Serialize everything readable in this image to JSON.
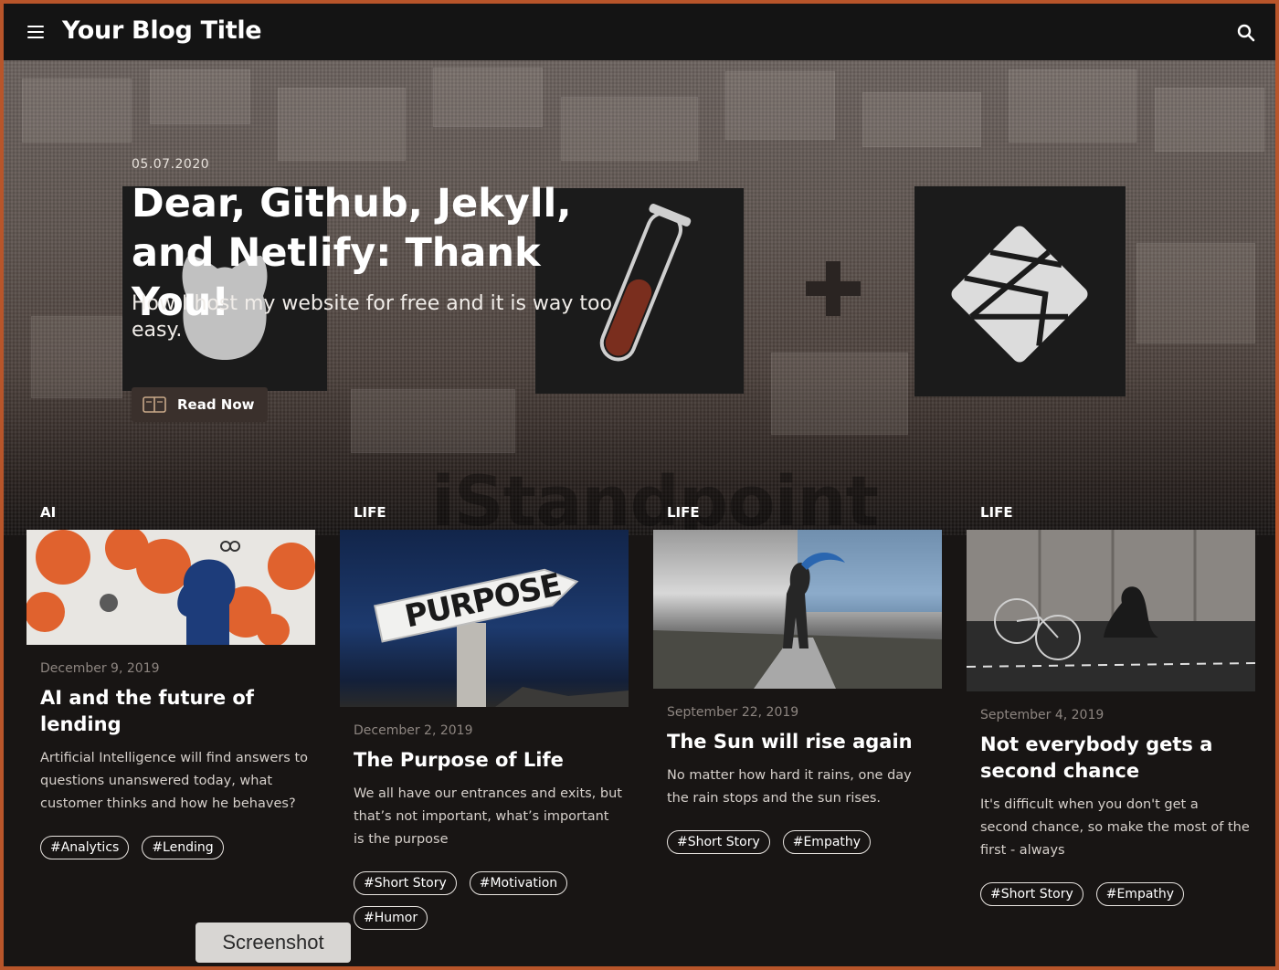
{
  "header": {
    "title": "Your Blog Title"
  },
  "hero": {
    "date": "05.07.2020",
    "title": "Dear, Github, Jekyll, and Netlify: Thank You!",
    "subtitle": "How I host my website for free and it is way too easy.",
    "read_button": "Read Now",
    "watermark": "iStandpoint"
  },
  "cards": [
    {
      "category": "AI",
      "date": "December 9, 2019",
      "title": "AI and the future of lending",
      "excerpt": "Artificial Intelligence will find answers to questions unanswered today, what customer thinks and how he behaves?",
      "tags": [
        "#Analytics",
        "#Lending"
      ]
    },
    {
      "category": "LIFE",
      "date": "December 2, 2019",
      "title": "The Purpose of Life",
      "excerpt": "We all have our entrances and exits, but that’s not important, what’s important is the purpose",
      "tags": [
        "#Short Story",
        "#Motivation",
        "#Humor"
      ],
      "image_text": "PURPOSE"
    },
    {
      "category": "LIFE",
      "date": "September 22, 2019",
      "title": "The Sun will rise again",
      "excerpt": "No matter how hard it rains, one day the rain stops and the sun rises.",
      "tags": [
        "#Short Story",
        "#Empathy"
      ]
    },
    {
      "category": "LIFE",
      "date": "September 4, 2019",
      "title": "Not everybody gets a second chance",
      "excerpt": "It's difficult when you don't get a second chance, so make the most of the first - always",
      "tags": [
        "#Short Story",
        "#Empathy"
      ]
    }
  ],
  "overlay": {
    "screenshot_label": "Screenshot"
  }
}
